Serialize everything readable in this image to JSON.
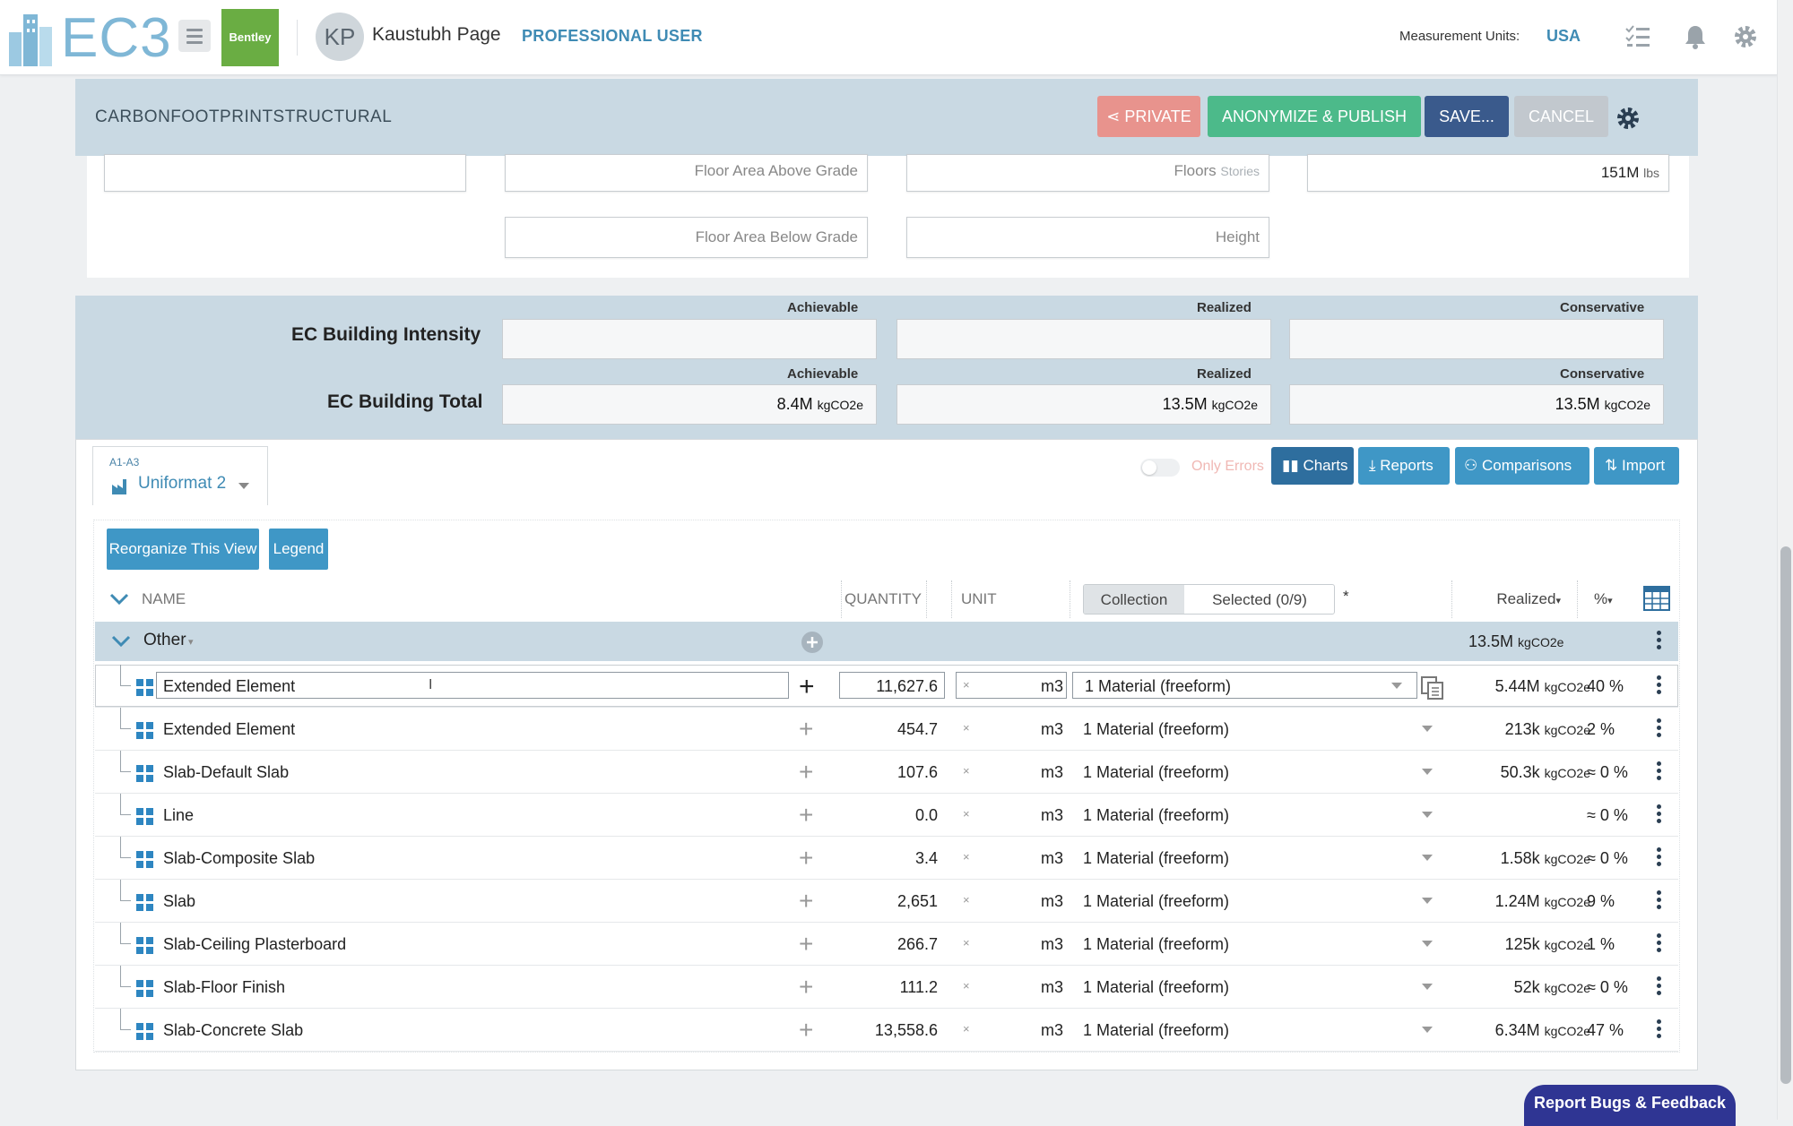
{
  "topbar": {
    "logo_text": "EC3",
    "bentley_label": "Bentley",
    "avatar_initials": "KP",
    "user_name": "Kaustubh Page",
    "user_role": "PROFESSIONAL USER",
    "measurement_label": "Measurement Units:",
    "measurement_value": "USA",
    "icons": [
      "hamburger-icon",
      "checklist-icon",
      "bell-icon",
      "gear-icon"
    ]
  },
  "project": {
    "name": "CARBONFOOTPRINTSTRUCTURAL",
    "private_label": "PRIVATE",
    "publish_label": "ANONYMIZE & PUBLISH",
    "save_label": "SAVE...",
    "cancel_label": "CANCEL"
  },
  "building_fields": {
    "floor_area_above": "Floor Area Above Grade",
    "floors": "Floors",
    "floors_unit": "Stories",
    "mass_value": "151M",
    "mass_unit": "lbs",
    "floor_area_below": "Floor Area Below Grade",
    "height": "Height"
  },
  "ec": {
    "intensity_label": "EC Building Intensity",
    "total_label": "EC Building Total",
    "col_achievable": "Achievable",
    "col_realized": "Realized",
    "col_conservative": "Conservative",
    "total_achievable": "8.4M",
    "total_realized": "13.5M",
    "total_conservative": "13.5M",
    "unit": "kgCO2e"
  },
  "tab": {
    "stage": "A1-A3",
    "name": "Uniformat 2"
  },
  "toolbar": {
    "only_errors": "Only Errors",
    "charts": "Charts",
    "reports": "Reports",
    "comparisons": "Comparisons",
    "import": "Import"
  },
  "view": {
    "reorganize": "Reorganize This View",
    "legend": "Legend"
  },
  "grid_header": {
    "name": "NAME",
    "quantity": "QUANTITY",
    "unit": "UNIT",
    "collection": "Collection",
    "selected": "Selected (0/9)",
    "asterisk": "*",
    "realized": "Realized",
    "percent": "%"
  },
  "group": {
    "name": "Other",
    "realized": "13.5M",
    "unit": "kgCO2e"
  },
  "rows": [
    {
      "name": "Extended Element",
      "qty": "11,627.6",
      "x": "×",
      "unit": "m3",
      "material": "1 Material (freeform)",
      "realized": "5.44M",
      "pct": "40 %"
    },
    {
      "name": "Extended Element",
      "qty": "454.7",
      "x": "×",
      "unit": "m3",
      "material": "1 Material (freeform)",
      "realized": "213k",
      "pct": "2 %"
    },
    {
      "name": "Slab-Default Slab",
      "qty": "107.6",
      "x": "×",
      "unit": "m3",
      "material": "1 Material (freeform)",
      "realized": "50.3k",
      "pct": "≈ 0 %"
    },
    {
      "name": "Line",
      "qty": "0.0",
      "x": "×",
      "unit": "m3",
      "material": "1 Material (freeform)",
      "realized": "",
      "pct": "≈ 0 %"
    },
    {
      "name": "Slab-Composite Slab",
      "qty": "3.4",
      "x": "×",
      "unit": "m3",
      "material": "1 Material (freeform)",
      "realized": "1.58k",
      "pct": "≈ 0 %"
    },
    {
      "name": "Slab",
      "qty": "2,651",
      "x": "×",
      "unit": "m3",
      "material": "1 Material (freeform)",
      "realized": "1.24M",
      "pct": "9 %"
    },
    {
      "name": "Slab-Ceiling Plasterboard",
      "qty": "266.7",
      "x": "×",
      "unit": "m3",
      "material": "1 Material (freeform)",
      "realized": "125k",
      "pct": "1 %"
    },
    {
      "name": "Slab-Floor Finish",
      "qty": "111.2",
      "x": "×",
      "unit": "m3",
      "material": "1 Material (freeform)",
      "realized": "52k",
      "pct": "≈ 0 %"
    },
    {
      "name": "Slab-Concrete Slab",
      "qty": "13,558.6",
      "x": "×",
      "unit": "m3",
      "material": "1 Material (freeform)",
      "realized": "6.34M",
      "pct": "47 %"
    }
  ],
  "feedback": "Report Bugs & Feedback"
}
